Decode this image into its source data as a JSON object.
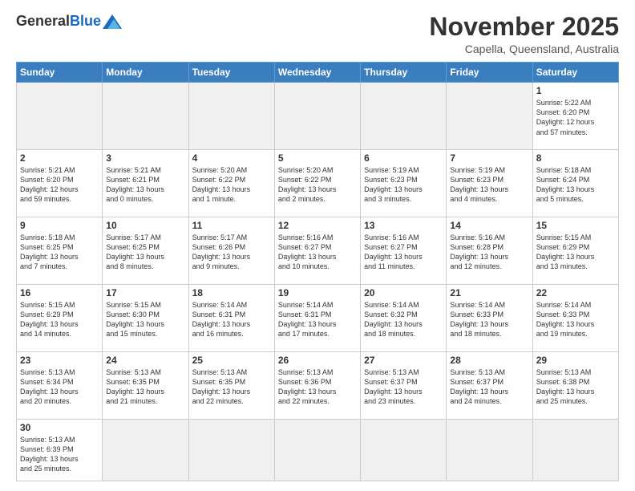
{
  "header": {
    "logo_general": "General",
    "logo_blue": "Blue",
    "month_title": "November 2025",
    "location": "Capella, Queensland, Australia"
  },
  "days_of_week": [
    "Sunday",
    "Monday",
    "Tuesday",
    "Wednesday",
    "Thursday",
    "Friday",
    "Saturday"
  ],
  "weeks": [
    [
      {
        "day": "",
        "info": "",
        "empty": true
      },
      {
        "day": "",
        "info": "",
        "empty": true
      },
      {
        "day": "",
        "info": "",
        "empty": true
      },
      {
        "day": "",
        "info": "",
        "empty": true
      },
      {
        "day": "",
        "info": "",
        "empty": true
      },
      {
        "day": "",
        "info": "",
        "empty": true
      },
      {
        "day": "1",
        "info": "Sunrise: 5:22 AM\nSunset: 6:20 PM\nDaylight: 12 hours\nand 57 minutes."
      }
    ],
    [
      {
        "day": "2",
        "info": "Sunrise: 5:21 AM\nSunset: 6:20 PM\nDaylight: 12 hours\nand 59 minutes."
      },
      {
        "day": "3",
        "info": "Sunrise: 5:21 AM\nSunset: 6:21 PM\nDaylight: 13 hours\nand 0 minutes."
      },
      {
        "day": "4",
        "info": "Sunrise: 5:20 AM\nSunset: 6:22 PM\nDaylight: 13 hours\nand 1 minute."
      },
      {
        "day": "5",
        "info": "Sunrise: 5:20 AM\nSunset: 6:22 PM\nDaylight: 13 hours\nand 2 minutes."
      },
      {
        "day": "6",
        "info": "Sunrise: 5:19 AM\nSunset: 6:23 PM\nDaylight: 13 hours\nand 3 minutes."
      },
      {
        "day": "7",
        "info": "Sunrise: 5:19 AM\nSunset: 6:23 PM\nDaylight: 13 hours\nand 4 minutes."
      },
      {
        "day": "8",
        "info": "Sunrise: 5:18 AM\nSunset: 6:24 PM\nDaylight: 13 hours\nand 5 minutes."
      }
    ],
    [
      {
        "day": "9",
        "info": "Sunrise: 5:18 AM\nSunset: 6:25 PM\nDaylight: 13 hours\nand 7 minutes."
      },
      {
        "day": "10",
        "info": "Sunrise: 5:17 AM\nSunset: 6:25 PM\nDaylight: 13 hours\nand 8 minutes."
      },
      {
        "day": "11",
        "info": "Sunrise: 5:17 AM\nSunset: 6:26 PM\nDaylight: 13 hours\nand 9 minutes."
      },
      {
        "day": "12",
        "info": "Sunrise: 5:16 AM\nSunset: 6:27 PM\nDaylight: 13 hours\nand 10 minutes."
      },
      {
        "day": "13",
        "info": "Sunrise: 5:16 AM\nSunset: 6:27 PM\nDaylight: 13 hours\nand 11 minutes."
      },
      {
        "day": "14",
        "info": "Sunrise: 5:16 AM\nSunset: 6:28 PM\nDaylight: 13 hours\nand 12 minutes."
      },
      {
        "day": "15",
        "info": "Sunrise: 5:15 AM\nSunset: 6:29 PM\nDaylight: 13 hours\nand 13 minutes."
      }
    ],
    [
      {
        "day": "16",
        "info": "Sunrise: 5:15 AM\nSunset: 6:29 PM\nDaylight: 13 hours\nand 14 minutes."
      },
      {
        "day": "17",
        "info": "Sunrise: 5:15 AM\nSunset: 6:30 PM\nDaylight: 13 hours\nand 15 minutes."
      },
      {
        "day": "18",
        "info": "Sunrise: 5:14 AM\nSunset: 6:31 PM\nDaylight: 13 hours\nand 16 minutes."
      },
      {
        "day": "19",
        "info": "Sunrise: 5:14 AM\nSunset: 6:31 PM\nDaylight: 13 hours\nand 17 minutes."
      },
      {
        "day": "20",
        "info": "Sunrise: 5:14 AM\nSunset: 6:32 PM\nDaylight: 13 hours\nand 18 minutes."
      },
      {
        "day": "21",
        "info": "Sunrise: 5:14 AM\nSunset: 6:33 PM\nDaylight: 13 hours\nand 18 minutes."
      },
      {
        "day": "22",
        "info": "Sunrise: 5:14 AM\nSunset: 6:33 PM\nDaylight: 13 hours\nand 19 minutes."
      }
    ],
    [
      {
        "day": "23",
        "info": "Sunrise: 5:13 AM\nSunset: 6:34 PM\nDaylight: 13 hours\nand 20 minutes."
      },
      {
        "day": "24",
        "info": "Sunrise: 5:13 AM\nSunset: 6:35 PM\nDaylight: 13 hours\nand 21 minutes."
      },
      {
        "day": "25",
        "info": "Sunrise: 5:13 AM\nSunset: 6:35 PM\nDaylight: 13 hours\nand 22 minutes."
      },
      {
        "day": "26",
        "info": "Sunrise: 5:13 AM\nSunset: 6:36 PM\nDaylight: 13 hours\nand 22 minutes."
      },
      {
        "day": "27",
        "info": "Sunrise: 5:13 AM\nSunset: 6:37 PM\nDaylight: 13 hours\nand 23 minutes."
      },
      {
        "day": "28",
        "info": "Sunrise: 5:13 AM\nSunset: 6:37 PM\nDaylight: 13 hours\nand 24 minutes."
      },
      {
        "day": "29",
        "info": "Sunrise: 5:13 AM\nSunset: 6:38 PM\nDaylight: 13 hours\nand 25 minutes."
      }
    ],
    [
      {
        "day": "30",
        "info": "Sunrise: 5:13 AM\nSunset: 6:39 PM\nDaylight: 13 hours\nand 25 minutes."
      },
      {
        "day": "",
        "info": "",
        "empty": true
      },
      {
        "day": "",
        "info": "",
        "empty": true
      },
      {
        "day": "",
        "info": "",
        "empty": true
      },
      {
        "day": "",
        "info": "",
        "empty": true
      },
      {
        "day": "",
        "info": "",
        "empty": true
      },
      {
        "day": "",
        "info": "",
        "empty": true
      }
    ]
  ]
}
